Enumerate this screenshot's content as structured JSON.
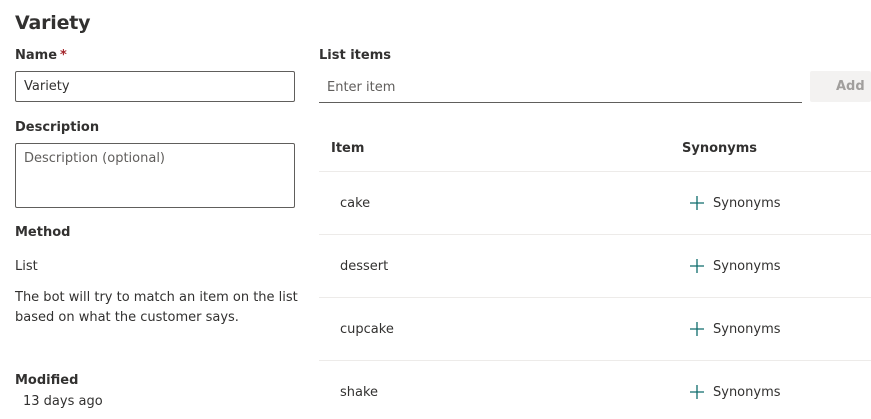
{
  "page_title": "Variety",
  "name": {
    "label": "Name",
    "required_mark": "*",
    "value": "Variety"
  },
  "description": {
    "label": "Description",
    "placeholder": "Description (optional)"
  },
  "method": {
    "label": "Method",
    "value": "List",
    "help": "The bot will try to match an item on the list based on what the customer says."
  },
  "modified": {
    "label": "Modified",
    "value": "13 days ago"
  },
  "list_items": {
    "label": "List items",
    "placeholder": "Enter item",
    "add_label": "Add",
    "columns": {
      "item": "Item",
      "synonyms": "Synonyms"
    },
    "rows": [
      {
        "item": "cake",
        "synonyms_label": "Synonyms"
      },
      {
        "item": "dessert",
        "synonyms_label": "Synonyms"
      },
      {
        "item": "cupcake",
        "synonyms_label": "Synonyms"
      },
      {
        "item": "shake",
        "synonyms_label": "Synonyms"
      }
    ]
  },
  "icons": {
    "add_synonym": "plus-icon"
  },
  "colors": {
    "text": "#323130",
    "required": "#a4262c",
    "border": "#605e5c",
    "divider": "#edebe9",
    "icon": "#0f6c6c"
  }
}
